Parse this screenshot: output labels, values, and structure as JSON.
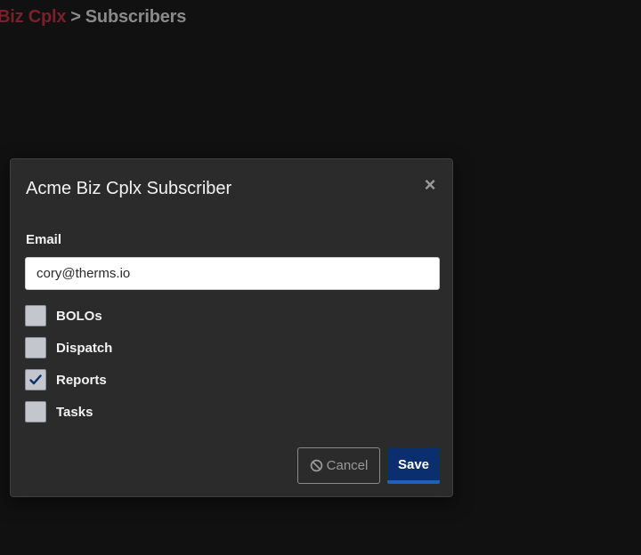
{
  "breadcrumb": {
    "parent": "Biz Cplx",
    "separator": ">",
    "current": "Subscribers"
  },
  "modal": {
    "title": "Acme Biz Cplx Subscriber",
    "close_icon": "close-icon",
    "email_label": "Email",
    "email_value": "cory@therms.io",
    "options": [
      {
        "label": "BOLOs",
        "checked": false
      },
      {
        "label": "Dispatch",
        "checked": false
      },
      {
        "label": "Reports",
        "checked": true
      },
      {
        "label": "Tasks",
        "checked": false
      }
    ],
    "cancel_label": "Cancel",
    "cancel_icon": "ban-icon",
    "save_label": "Save"
  },
  "colors": {
    "background": "#121112",
    "modal_bg": "#2b2b2c",
    "breadcrumb_link": "#7a1f2c",
    "save_bg": "#0b2f6e",
    "save_border": "#1e5fbf",
    "checkmark": "#0b2f6e"
  }
}
